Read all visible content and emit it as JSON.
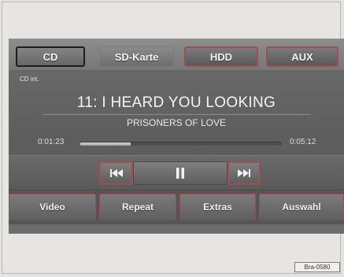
{
  "tabs": [
    {
      "label": "CD",
      "active": true
    },
    {
      "label": "SD-Karte",
      "active": false
    },
    {
      "label": "HDD",
      "active": false
    },
    {
      "label": "AUX",
      "active": false
    }
  ],
  "source_label": "CD int.",
  "track": {
    "title": "11: I HEARD YOU LOOKING",
    "artist": "PRISONERS OF LOVE"
  },
  "playback": {
    "elapsed": "0:01:23",
    "total": "0:05:12",
    "progress": 0.25
  },
  "controls": {
    "previous_icon": "skip-previous-icon",
    "pause_icon": "pause-icon",
    "next_icon": "skip-next-icon"
  },
  "bottom_tabs": [
    "Video",
    "Repeat",
    "Extras",
    "Auswahl"
  ],
  "figure_ref": "Bra-0580",
  "colors": {
    "accent_border": "#a34b57",
    "icon": "#f2f2f2"
  }
}
